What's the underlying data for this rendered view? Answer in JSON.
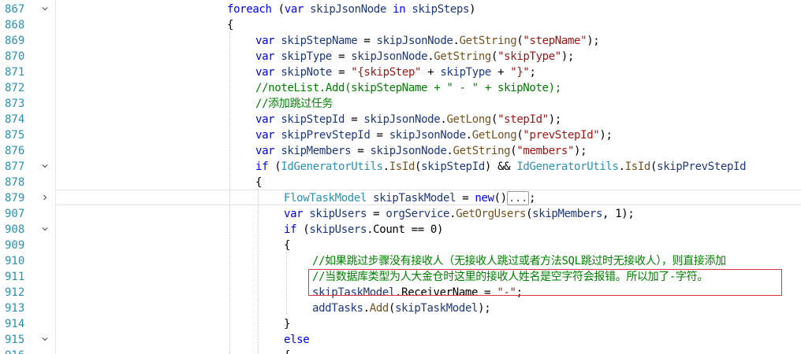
{
  "editor": {
    "lines": [
      {
        "num": "867",
        "fold": "expanded",
        "indent": 8,
        "tokens": [
          [
            "kw",
            "foreach"
          ],
          [
            "plain",
            " ("
          ],
          [
            "kw",
            "var"
          ],
          [
            "plain",
            " "
          ],
          [
            "var",
            "skipJsonNode"
          ],
          [
            "plain",
            " "
          ],
          [
            "kw",
            "in"
          ],
          [
            "plain",
            " "
          ],
          [
            "var",
            "skipSteps"
          ],
          [
            "plain",
            ")"
          ]
        ]
      },
      {
        "num": "868",
        "fold": "none",
        "indent": 8,
        "tokens": [
          [
            "plain",
            "{"
          ]
        ]
      },
      {
        "num": "869",
        "fold": "none",
        "indent": 9,
        "tokens": [
          [
            "kw",
            "var"
          ],
          [
            "plain",
            " "
          ],
          [
            "var",
            "skipStepName"
          ],
          [
            "plain",
            " = "
          ],
          [
            "var",
            "skipJsonNode"
          ],
          [
            "plain",
            "."
          ],
          [
            "mth",
            "GetString"
          ],
          [
            "plain",
            "("
          ],
          [
            "str",
            "\"stepName\""
          ],
          [
            "plain",
            ");"
          ]
        ]
      },
      {
        "num": "870",
        "fold": "none",
        "indent": 9,
        "tokens": [
          [
            "kw",
            "var"
          ],
          [
            "plain",
            " "
          ],
          [
            "var",
            "skipType"
          ],
          [
            "plain",
            " = "
          ],
          [
            "var",
            "skipJsonNode"
          ],
          [
            "plain",
            "."
          ],
          [
            "mth",
            "GetString"
          ],
          [
            "plain",
            "("
          ],
          [
            "str",
            "\"skipType\""
          ],
          [
            "plain",
            ");"
          ]
        ]
      },
      {
        "num": "871",
        "fold": "none",
        "indent": 9,
        "tokens": [
          [
            "kw",
            "var"
          ],
          [
            "plain",
            " "
          ],
          [
            "var",
            "skipNote"
          ],
          [
            "plain",
            " = "
          ],
          [
            "str",
            "\"{skipStep\""
          ],
          [
            "plain",
            " + "
          ],
          [
            "var",
            "skipType"
          ],
          [
            "plain",
            " + "
          ],
          [
            "str",
            "\"}\""
          ],
          [
            "plain",
            ";"
          ]
        ]
      },
      {
        "num": "872",
        "fold": "none",
        "indent": 9,
        "tokens": [
          [
            "com",
            "//noteList.Add(skipStepName + \" - \" + skipNote);"
          ]
        ]
      },
      {
        "num": "873",
        "fold": "none",
        "indent": 9,
        "tokens": [
          [
            "com",
            "//添加跳过任务"
          ]
        ]
      },
      {
        "num": "874",
        "fold": "none",
        "indent": 9,
        "tokens": [
          [
            "kw",
            "var"
          ],
          [
            "plain",
            " "
          ],
          [
            "var",
            "skipStepId"
          ],
          [
            "plain",
            " = "
          ],
          [
            "var",
            "skipJsonNode"
          ],
          [
            "plain",
            "."
          ],
          [
            "mth",
            "GetLong"
          ],
          [
            "plain",
            "("
          ],
          [
            "str",
            "\"stepId\""
          ],
          [
            "plain",
            ");"
          ]
        ]
      },
      {
        "num": "875",
        "fold": "none",
        "indent": 9,
        "tokens": [
          [
            "kw",
            "var"
          ],
          [
            "plain",
            " "
          ],
          [
            "var",
            "skipPrevStepId"
          ],
          [
            "plain",
            " = "
          ],
          [
            "var",
            "skipJsonNode"
          ],
          [
            "plain",
            "."
          ],
          [
            "mth",
            "GetLong"
          ],
          [
            "plain",
            "("
          ],
          [
            "str",
            "\"prevStepId\""
          ],
          [
            "plain",
            ");"
          ]
        ]
      },
      {
        "num": "876",
        "fold": "none",
        "indent": 9,
        "tokens": [
          [
            "kw",
            "var"
          ],
          [
            "plain",
            " "
          ],
          [
            "var",
            "skipMembers"
          ],
          [
            "plain",
            " = "
          ],
          [
            "var",
            "skipJsonNode"
          ],
          [
            "plain",
            "."
          ],
          [
            "mth",
            "GetString"
          ],
          [
            "plain",
            "("
          ],
          [
            "str",
            "\"members\""
          ],
          [
            "plain",
            ");"
          ]
        ]
      },
      {
        "num": "877",
        "fold": "expanded",
        "indent": 9,
        "tokens": [
          [
            "kw",
            "if"
          ],
          [
            "plain",
            " ("
          ],
          [
            "cls",
            "IdGeneratorUtils"
          ],
          [
            "plain",
            "."
          ],
          [
            "mth",
            "IsId"
          ],
          [
            "plain",
            "("
          ],
          [
            "var",
            "skipStepId"
          ],
          [
            "plain",
            ") && "
          ],
          [
            "cls",
            "IdGeneratorUtils"
          ],
          [
            "plain",
            "."
          ],
          [
            "mth",
            "IsId"
          ],
          [
            "plain",
            "("
          ],
          [
            "var",
            "skipPrevStepId"
          ]
        ]
      },
      {
        "num": "878",
        "fold": "none",
        "indent": 9,
        "tokens": [
          [
            "plain",
            "{"
          ]
        ]
      },
      {
        "num": "879",
        "fold": "collapsed",
        "indent": 10,
        "tokens": [
          [
            "cls",
            "FlowTaskModel"
          ],
          [
            "plain",
            " "
          ],
          [
            "var",
            "skipTaskModel"
          ],
          [
            "plain",
            " = "
          ],
          [
            "kw",
            "new"
          ],
          [
            "plain",
            "()"
          ],
          [
            "collapsed",
            "..."
          ],
          [
            "plain",
            ";"
          ]
        ]
      },
      {
        "num": "907",
        "fold": "none",
        "indent": 10,
        "tokens": [
          [
            "kw",
            "var"
          ],
          [
            "plain",
            " "
          ],
          [
            "var",
            "skipUsers"
          ],
          [
            "plain",
            " = "
          ],
          [
            "var",
            "orgService"
          ],
          [
            "plain",
            "."
          ],
          [
            "mth",
            "GetOrgUsers"
          ],
          [
            "plain",
            "("
          ],
          [
            "var",
            "skipMembers"
          ],
          [
            "plain",
            ", 1);"
          ]
        ]
      },
      {
        "num": "908",
        "fold": "expanded",
        "indent": 10,
        "tokens": [
          [
            "kw",
            "if"
          ],
          [
            "plain",
            " ("
          ],
          [
            "var",
            "skipUsers"
          ],
          [
            "plain",
            "."
          ],
          [
            "plain",
            "Count == 0)"
          ]
        ]
      },
      {
        "num": "909",
        "fold": "none",
        "indent": 10,
        "tokens": [
          [
            "plain",
            "{"
          ]
        ]
      },
      {
        "num": "910",
        "fold": "none",
        "indent": 11,
        "tokens": [
          [
            "com",
            "//如果跳过步骤没有接收人（无接收人跳过或者方法SQL跳过时无接收人），则直接添加"
          ]
        ]
      },
      {
        "num": "911",
        "fold": "none",
        "indent": 11,
        "tokens": [
          [
            "com",
            "//当数据库类型为人大金仓时这里的接收人姓名是空字符会报错。所以加了-字符。"
          ]
        ]
      },
      {
        "num": "912",
        "fold": "none",
        "indent": 11,
        "tokens": [
          [
            "var",
            "skipTaskModel"
          ],
          [
            "plain",
            "."
          ],
          [
            "plain",
            "ReceiverName = "
          ],
          [
            "str",
            "\"-\""
          ],
          [
            "plain",
            ";"
          ]
        ]
      },
      {
        "num": "913",
        "fold": "none",
        "indent": 11,
        "tokens": [
          [
            "var",
            "addTasks"
          ],
          [
            "plain",
            "."
          ],
          [
            "mth",
            "Add"
          ],
          [
            "plain",
            "("
          ],
          [
            "var",
            "skipTaskModel"
          ],
          [
            "plain",
            ");"
          ]
        ]
      },
      {
        "num": "914",
        "fold": "none",
        "indent": 10,
        "tokens": [
          [
            "plain",
            "}"
          ]
        ]
      },
      {
        "num": "915",
        "fold": "expanded",
        "indent": 10,
        "tokens": [
          [
            "kw",
            "else"
          ]
        ]
      },
      {
        "num": "916",
        "fold": "none",
        "indent": 10,
        "tokens": [
          [
            "plain",
            "{"
          ]
        ]
      }
    ]
  }
}
